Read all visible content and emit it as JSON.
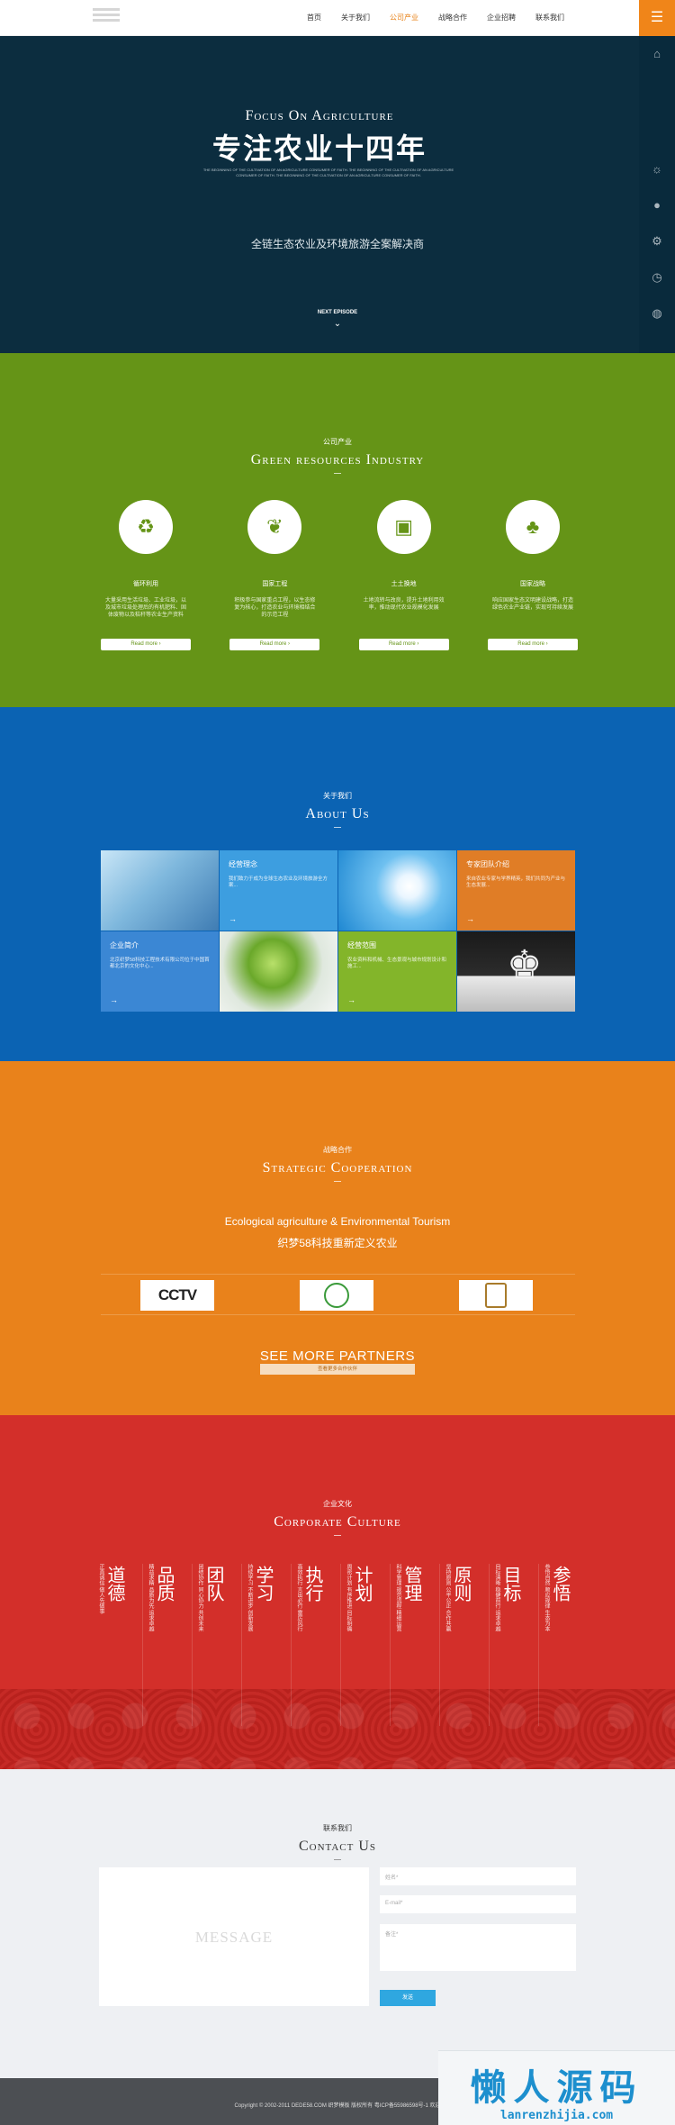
{
  "nav": {
    "items": [
      "首页",
      "关于我们",
      "公司产业",
      "战略合作",
      "企业招聘",
      "联系我们"
    ],
    "menu_icon": "menu-icon"
  },
  "rail": {
    "icons": [
      "home-icon",
      "sun-icon",
      "user-icon",
      "gear-icon",
      "clock-icon",
      "globe-icon"
    ]
  },
  "hero": {
    "title_en": "Focus On Agriculture",
    "title_cn": "专注农业十四年",
    "small_text": "THE BEGINNING OF THE CULTIVATION OF AN AGRICULTURE CONSUMER OF FAITH. THE BEGINNING OF THE CULTIVATION OF AN AGRICULTURE CONSUMER OF FAITH. THE BEGINNING OF THE CULTIVATION OF AN AGRICULTURE CONSUMER OF FAITH.",
    "subtitle": "全链生态农业及环境旅游全案解决商",
    "next": "NEXT EPISODE"
  },
  "industry": {
    "subtitle": "公司产业",
    "title": "Green resources Industry",
    "cards": [
      {
        "icon": "recycle-icon",
        "title": "循环利用",
        "desc": "大量采用生活垃圾、工业垃圾，以及城市垃圾处理后的有机肥料、固体废物以及秸秆等农业生产资料",
        "more": "Read more  ›"
      },
      {
        "icon": "leaf-globe-icon",
        "title": "国家工程",
        "desc": "积极参与国家重点工程，以生态修复为核心，打造农业与环境相结合的示范工程",
        "more": "Read more  ›"
      },
      {
        "icon": "soil-icon",
        "title": "土土换地",
        "desc": "土地流转与改良，提升土地利用效率，推动现代农业规模化发展",
        "more": "Read more  ›"
      },
      {
        "icon": "tree-icon",
        "title": "国家战略",
        "desc": "响应国家生态文明建设战略，打造绿色农业产业链，实现可持续发展",
        "more": "Read more  ›"
      }
    ]
  },
  "about": {
    "subtitle": "关于我们",
    "title": "About Us",
    "tiles": [
      {
        "title": "经营理念",
        "desc": "我们致力于成为全球生态农业及环境旅游全方案..."
      },
      {
        "title": "专家团队介绍",
        "desc": "来自农业专家与学界精英，我们共同为产业与生态发展..."
      },
      {
        "title": "企业简介",
        "desc": "北京织梦58科技工程技术有限公司位于中国首都北京的文化中心..."
      },
      {
        "title": "经营范围",
        "desc": "农业资料和机械、生态景观与城市规划设计和施工..."
      }
    ],
    "arrow": "→"
  },
  "strategic": {
    "subtitle": "战略合作",
    "title": "Strategic Cooperation",
    "line_en": "Ecological agriculture & Environmental Tourism",
    "line_cn": "织梦58科技重新定义农业",
    "partners": [
      "CCTV"
    ],
    "more": "SEE MORE PARTNERS",
    "more_btn": "查看更多合作伙伴"
  },
  "culture": {
    "subtitle": "企业文化",
    "title": "Corporate Culture",
    "columns": [
      {
        "big": "道德",
        "text": "正直诚信 做人先做事"
      },
      {
        "big": "品质",
        "text": "精益求精 品质为先 追求卓越"
      },
      {
        "big": "团队",
        "text": "团结协作 同心协力 共创未来"
      },
      {
        "big": "学习",
        "text": "持续学习 不断进步 创新发展"
      },
      {
        "big": "执行",
        "text": "高效执行 言出必行 雷厉风行"
      },
      {
        "big": "计划",
        "text": "周密计划 有序推进 目标明确"
      },
      {
        "big": "管理",
        "text": "科学管理 规范流程 精细运营"
      },
      {
        "big": "原则",
        "text": "坚持原则 公平公正 合作共赢"
      },
      {
        "big": "目标",
        "text": "目标清晰 稳健前行 追求卓越"
      },
      {
        "big": "参悟",
        "text": "参悟自然 顺应规律 生态为本"
      }
    ]
  },
  "contact": {
    "subtitle": "联系我们",
    "title": "Contact Us",
    "message_placeholder": "MESSAGE",
    "name_placeholder": "姓名*",
    "email_placeholder": "E-mail*",
    "note_placeholder": "备注*",
    "submit": "发送"
  },
  "footer": {
    "copyright": "Copyright © 2002-2011 DEDE58.COM 织梦模板 版权所有  粤ICP备55986598号-1    欢迎"
  },
  "watermark": {
    "cn": "懒人源码",
    "url": "lanrenzhijia.com"
  },
  "colors": {
    "hero": "#0c2d3f",
    "industry": "#659417",
    "about": "#0b63b3",
    "strategic": "#e9821b",
    "culture": "#d32f2a",
    "accent": "#f08519"
  }
}
